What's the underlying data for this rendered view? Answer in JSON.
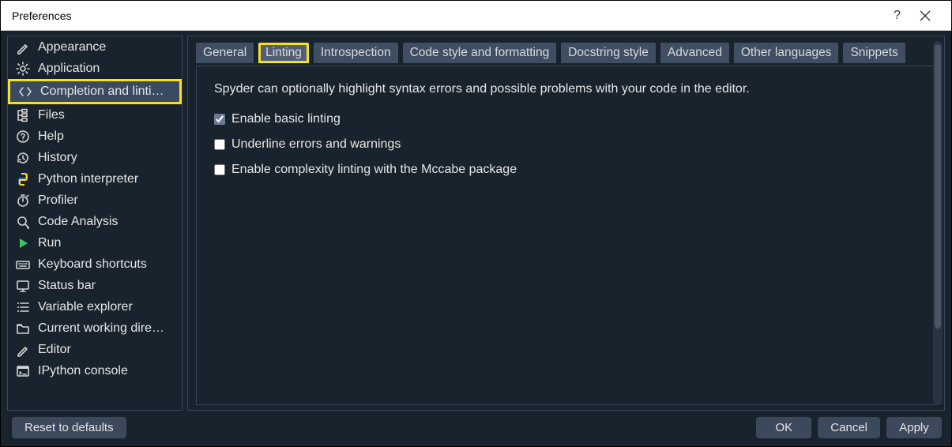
{
  "window": {
    "title": "Preferences",
    "help_glyph": "?",
    "close_label": "Close"
  },
  "sidebar": {
    "items": [
      {
        "icon": "brush",
        "label": "Appearance"
      },
      {
        "icon": "gear",
        "label": "Application"
      },
      {
        "icon": "angles",
        "label": "Completion and linti…",
        "selected": true
      },
      {
        "icon": "tree",
        "label": "Files"
      },
      {
        "icon": "help",
        "label": "Help"
      },
      {
        "icon": "history",
        "label": "History"
      },
      {
        "icon": "python",
        "label": "Python interpreter"
      },
      {
        "icon": "stopwatch",
        "label": "Profiler"
      },
      {
        "icon": "search",
        "label": "Code Analysis"
      },
      {
        "icon": "play",
        "label": "Run"
      },
      {
        "icon": "keyboard",
        "label": "Keyboard shortcuts"
      },
      {
        "icon": "monitor",
        "label": "Status bar"
      },
      {
        "icon": "list",
        "label": "Variable explorer"
      },
      {
        "icon": "folder",
        "label": "Current working dire…"
      },
      {
        "icon": "pencil",
        "label": "Editor"
      },
      {
        "icon": "terminal",
        "label": "IPython console"
      }
    ]
  },
  "tabs": [
    {
      "label": "General"
    },
    {
      "label": "Linting",
      "active": true
    },
    {
      "label": "Introspection"
    },
    {
      "label": "Code style and formatting"
    },
    {
      "label": "Docstring style"
    },
    {
      "label": "Advanced"
    },
    {
      "label": "Other languages"
    },
    {
      "label": "Snippets"
    }
  ],
  "pane": {
    "description": "Spyder can optionally highlight syntax errors and possible problems with your code in the editor.",
    "checkboxes": [
      {
        "label": "Enable basic linting",
        "checked": true
      },
      {
        "label": "Underline errors and warnings",
        "checked": false
      },
      {
        "label": "Enable complexity linting with the Mccabe package",
        "checked": false
      }
    ]
  },
  "footer": {
    "reset": "Reset to defaults",
    "ok": "OK",
    "cancel": "Cancel",
    "apply": "Apply"
  }
}
